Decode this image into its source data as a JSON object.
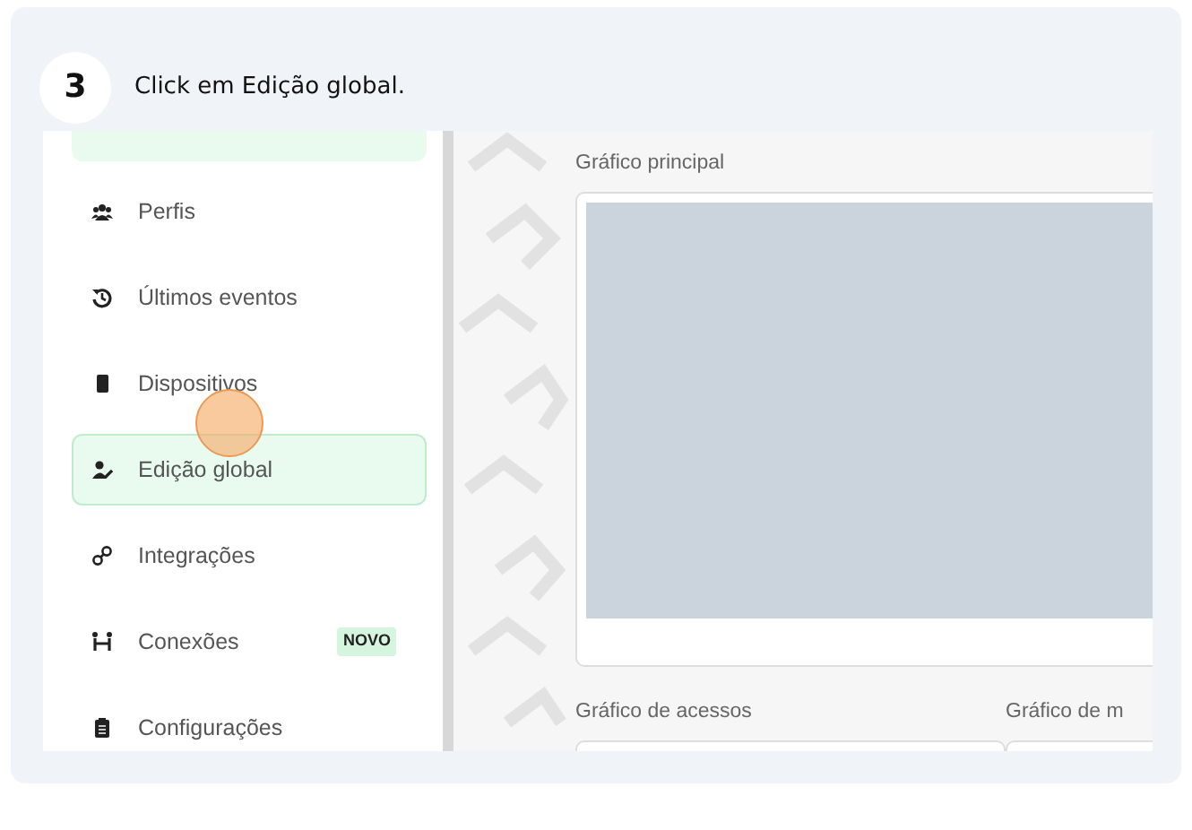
{
  "step": {
    "number": "3",
    "instruction": "Click em Edição global."
  },
  "sidebar": {
    "items": [
      {
        "kind": "cut",
        "selected": true
      },
      {
        "kind": "item",
        "label": "Perfis",
        "selected": false
      },
      {
        "kind": "item",
        "label": "Últimos eventos",
        "selected": false
      },
      {
        "kind": "item",
        "label": "Dispositivos",
        "selected": false
      },
      {
        "kind": "item",
        "label": "Edição global",
        "selected": true,
        "clicked": true
      },
      {
        "kind": "item",
        "label": "Integrações",
        "selected": false
      },
      {
        "kind": "item",
        "label": "Conexões",
        "badge": "NOVO",
        "selected": false
      },
      {
        "kind": "item",
        "label": "Configurações",
        "selected": false
      }
    ]
  },
  "main": {
    "main_chart_title": "Gráfico principal",
    "bottom_titles": [
      "Gráfico de acessos",
      "Gráfico de m"
    ]
  }
}
